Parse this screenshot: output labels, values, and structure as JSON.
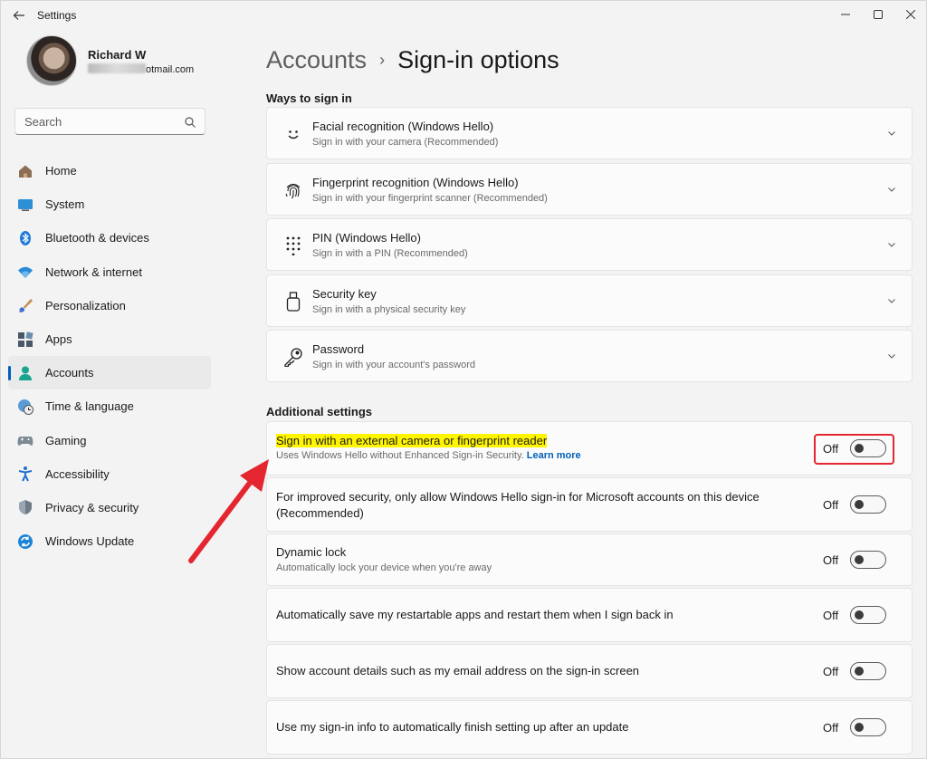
{
  "window": {
    "title": "Settings"
  },
  "profile": {
    "name": "Richard W",
    "email_visible": "otmail.com"
  },
  "search": {
    "placeholder": "Search"
  },
  "nav": {
    "items": [
      {
        "label": "Home",
        "icon": "home-icon"
      },
      {
        "label": "System",
        "icon": "monitor-icon"
      },
      {
        "label": "Bluetooth & devices",
        "icon": "bluetooth-icon"
      },
      {
        "label": "Network & internet",
        "icon": "wifi-icon"
      },
      {
        "label": "Personalization",
        "icon": "brush-icon"
      },
      {
        "label": "Apps",
        "icon": "apps-icon"
      },
      {
        "label": "Accounts",
        "icon": "account-icon",
        "active": true
      },
      {
        "label": "Time & language",
        "icon": "globe-clock-icon"
      },
      {
        "label": "Gaming",
        "icon": "gamepad-icon"
      },
      {
        "label": "Accessibility",
        "icon": "accessibility-icon"
      },
      {
        "label": "Privacy & security",
        "icon": "shield-icon"
      },
      {
        "label": "Windows Update",
        "icon": "update-icon"
      }
    ]
  },
  "breadcrumb": {
    "parent": "Accounts",
    "current": "Sign-in options"
  },
  "ways": {
    "title": "Ways to sign in",
    "items": [
      {
        "title": "Facial recognition (Windows Hello)",
        "sub": "Sign in with your camera (Recommended)",
        "icon": "smile-icon"
      },
      {
        "title": "Fingerprint recognition (Windows Hello)",
        "sub": "Sign in with your fingerprint scanner (Recommended)",
        "icon": "fingerprint-icon"
      },
      {
        "title": "PIN (Windows Hello)",
        "sub": "Sign in with a PIN (Recommended)",
        "icon": "pin-keypad-icon"
      },
      {
        "title": "Security key",
        "sub": "Sign in with a physical security key",
        "icon": "usb-key-icon"
      },
      {
        "title": "Password",
        "sub": "Sign in with your account's password",
        "icon": "key-icon"
      }
    ]
  },
  "additional": {
    "title": "Additional settings",
    "items": [
      {
        "title": "Sign in with an external camera or fingerprint reader",
        "sub": "Uses Windows Hello without Enhanced Sign-in Security.",
        "link": "Learn more",
        "state": "Off"
      },
      {
        "title": "For improved security, only allow Windows Hello sign-in for Microsoft accounts on this device (Recommended)",
        "state": "Off"
      },
      {
        "title": "Dynamic lock",
        "sub": "Automatically lock your device when you're away",
        "state": "Off"
      },
      {
        "title": "Automatically save my restartable apps and restart them when I sign back in",
        "state": "Off"
      },
      {
        "title": "Show account details such as my email address on the sign-in screen",
        "state": "Off"
      },
      {
        "title": "Use my sign-in info to automatically finish setting up after an update",
        "state": "Off"
      }
    ]
  },
  "colors": {
    "accent": "#005fb8",
    "highlight": "#fff500",
    "annotation": "#e3262f"
  }
}
